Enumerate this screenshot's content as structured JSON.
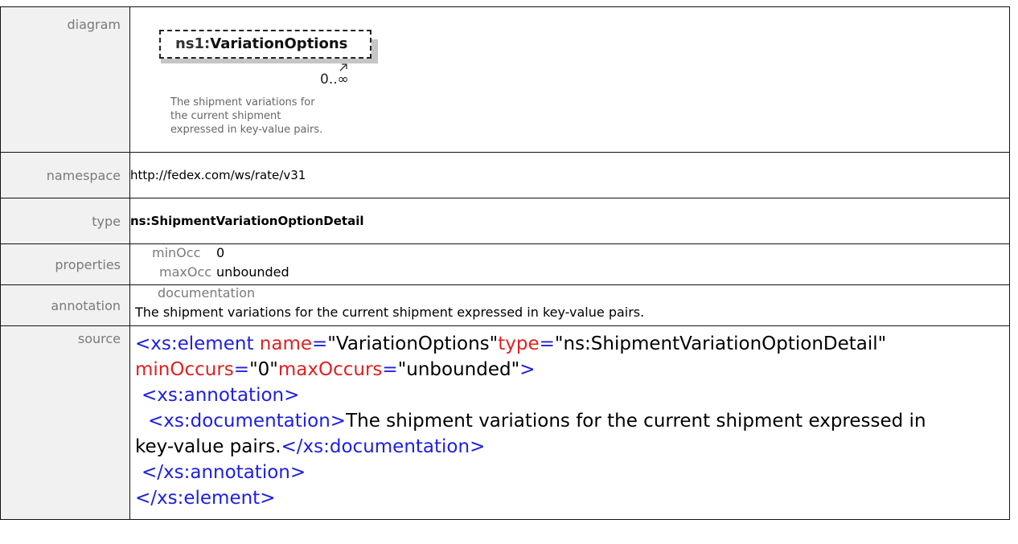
{
  "rows": {
    "diagram": {
      "label": "diagram",
      "element_prefix": "ns1:",
      "element_name": "VariationOptions",
      "occurrence": "0..∞",
      "doc_lines": [
        "The shipment variations for",
        "the current shipment",
        "expressed in key-value pairs."
      ]
    },
    "namespace": {
      "label": "namespace",
      "value": "http://fedex.com/ws/rate/v31"
    },
    "type": {
      "label": "type",
      "value": "ns:ShipmentVariationOptionDetail"
    },
    "properties": {
      "label": "properties",
      "min_key": "minOcc",
      "min_value": "0",
      "max_key": "maxOcc",
      "max_value": "unbounded"
    },
    "annotation": {
      "label": "annotation",
      "doc_key": "documentation",
      "doc_value": "The shipment variations for the current shipment expressed in key-value pairs."
    },
    "source": {
      "label": "source",
      "l1_tag": "<xs:element",
      "l1_attr1": "name",
      "l1_val1": "\"VariationOptions\"",
      "l1_attr2": "type",
      "l1_val2": "\"ns:ShipmentVariationOptionDetail\"",
      "l2_attr1": "minOccurs",
      "l2_val1": "\"0\"",
      "l2_attr2": "maxOccurs",
      "l2_val2": "\"unbounded\"",
      "l2_close": ">",
      "l3_tag": "<xs:annotation>",
      "l4_tag": "<xs:documentation>",
      "l4_text": "The shipment variations for the current shipment expressed in",
      "l5_text": "key-value pairs.",
      "l5_tag": "</xs:documentation>",
      "l6_tag": "</xs:annotation>",
      "l7_tag": "</xs:element>"
    }
  }
}
